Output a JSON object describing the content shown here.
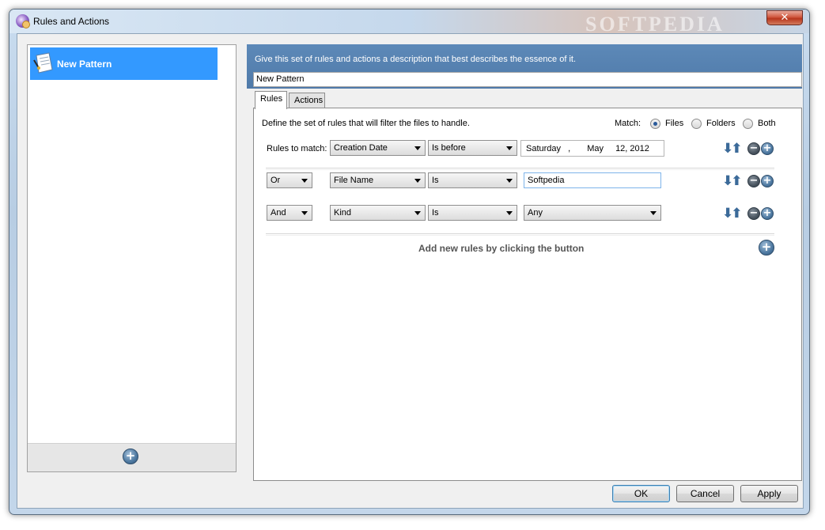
{
  "window": {
    "title": "Rules and Actions",
    "watermark": "SOFTPEDIA",
    "close_label": "✕"
  },
  "patterns": {
    "items": [
      {
        "label": "New Pattern",
        "selected": true
      }
    ],
    "add_label": "+"
  },
  "description": {
    "hint": "Give this set of rules and actions a description that best describes the essence of it.",
    "value": "New Pattern"
  },
  "tabs": [
    {
      "label": "Rules",
      "active": true
    },
    {
      "label": "Actions",
      "active": false
    }
  ],
  "rules": {
    "define_text": "Define the set of rules that will filter the files to handle.",
    "match_label": "Match:",
    "match_options": [
      {
        "label": "Files",
        "checked": true
      },
      {
        "label": "Folders",
        "checked": false
      },
      {
        "label": "Both",
        "checked": false
      }
    ],
    "rules_to_match_label": "Rules to match:",
    "rows": [
      {
        "connector": null,
        "field": "Creation Date",
        "operator": "Is before",
        "date_weekday": "Saturday",
        "date_sep": ",",
        "date_month": "May",
        "date_daydate": "12, 2012"
      },
      {
        "connector": "Or",
        "field": "File Name",
        "operator": "Is",
        "text_value": "Softpedia"
      },
      {
        "connector": "And",
        "field": "Kind",
        "operator": "Is",
        "select_value": "Any"
      }
    ],
    "add_hint": "Add new rules by clicking the button",
    "move_arrows": "⬇⬆",
    "remove_label": "−",
    "add_label": "+"
  },
  "buttons": {
    "ok": "OK",
    "cancel": "Cancel",
    "apply": "Apply"
  }
}
